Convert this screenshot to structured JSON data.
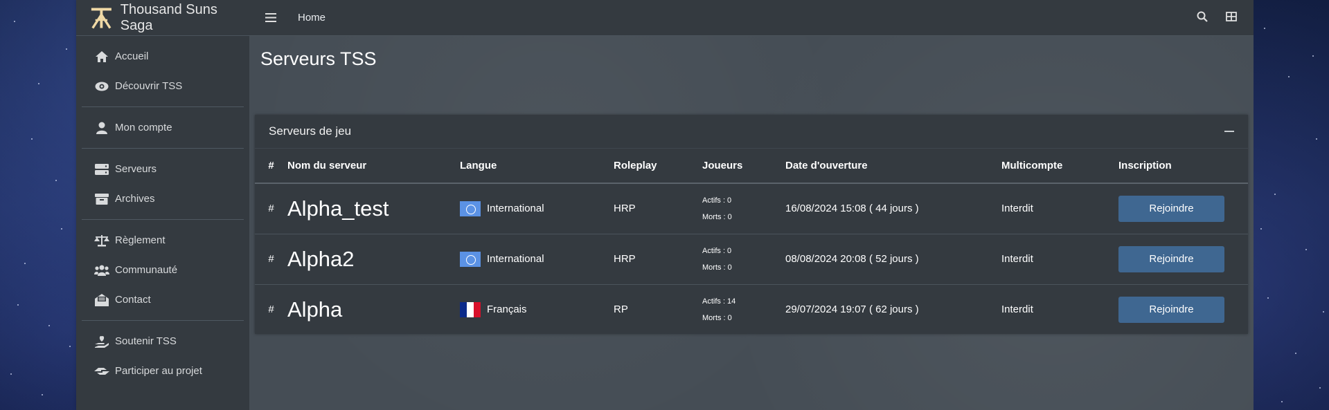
{
  "brand": {
    "name": "Thousand Suns Saga",
    "logo_icon": "tss-logo-icon"
  },
  "sidebar": {
    "groups": [
      [
        {
          "label": "Accueil",
          "icon": "home-icon"
        },
        {
          "label": "Découvrir TSS",
          "icon": "eye-icon"
        }
      ],
      [
        {
          "label": "Mon compte",
          "icon": "user-icon"
        }
      ],
      [
        {
          "label": "Serveurs",
          "icon": "server-icon"
        },
        {
          "label": "Archives",
          "icon": "archive-icon"
        }
      ],
      [
        {
          "label": "Règlement",
          "icon": "balance-scale-icon"
        },
        {
          "label": "Communauté",
          "icon": "users-icon"
        },
        {
          "label": "Contact",
          "icon": "envelope-open-icon"
        }
      ],
      [
        {
          "label": "Soutenir TSS",
          "icon": "hand-holding-heart-icon"
        },
        {
          "label": "Participer au projet",
          "icon": "hands-helping-icon"
        }
      ]
    ]
  },
  "topbar": {
    "home_label": "Home"
  },
  "page": {
    "title": "Serveurs TSS"
  },
  "card": {
    "title": "Serveurs de jeu",
    "columns": [
      "#",
      "Nom du serveur",
      "Langue",
      "Roleplay",
      "Joueurs",
      "Date d'ouverture",
      "Multicompte",
      "Inscription"
    ],
    "rows": [
      {
        "hash": "#",
        "name": "Alpha_test",
        "flag": "un-flag",
        "language": "International",
        "roleplay": "HRP",
        "actifs": "Actifs : 0",
        "morts": "Morts : 0",
        "date": "16/08/2024 15:08 ( 44 jours )",
        "multicompte": "Interdit",
        "button": "Rejoindre"
      },
      {
        "hash": "#",
        "name": "Alpha2",
        "flag": "un-flag",
        "language": "International",
        "roleplay": "HRP",
        "actifs": "Actifs : 0",
        "morts": "Morts : 0",
        "date": "08/08/2024 20:08 ( 52 jours )",
        "multicompte": "Interdit",
        "button": "Rejoindre"
      },
      {
        "hash": "#",
        "name": "Alpha",
        "flag": "france-flag",
        "language": "Français",
        "roleplay": "RP",
        "actifs": "Actifs : 14",
        "morts": "Morts : 0",
        "date": "29/07/2024 19:07 ( 62 jours )",
        "multicompte": "Interdit",
        "button": "Rejoindre"
      }
    ]
  },
  "colors": {
    "sidebar_bg": "#343a40",
    "content_bg": "#454d55",
    "button_bg": "#3f6791",
    "brand_gold": "#f0d9a6"
  }
}
